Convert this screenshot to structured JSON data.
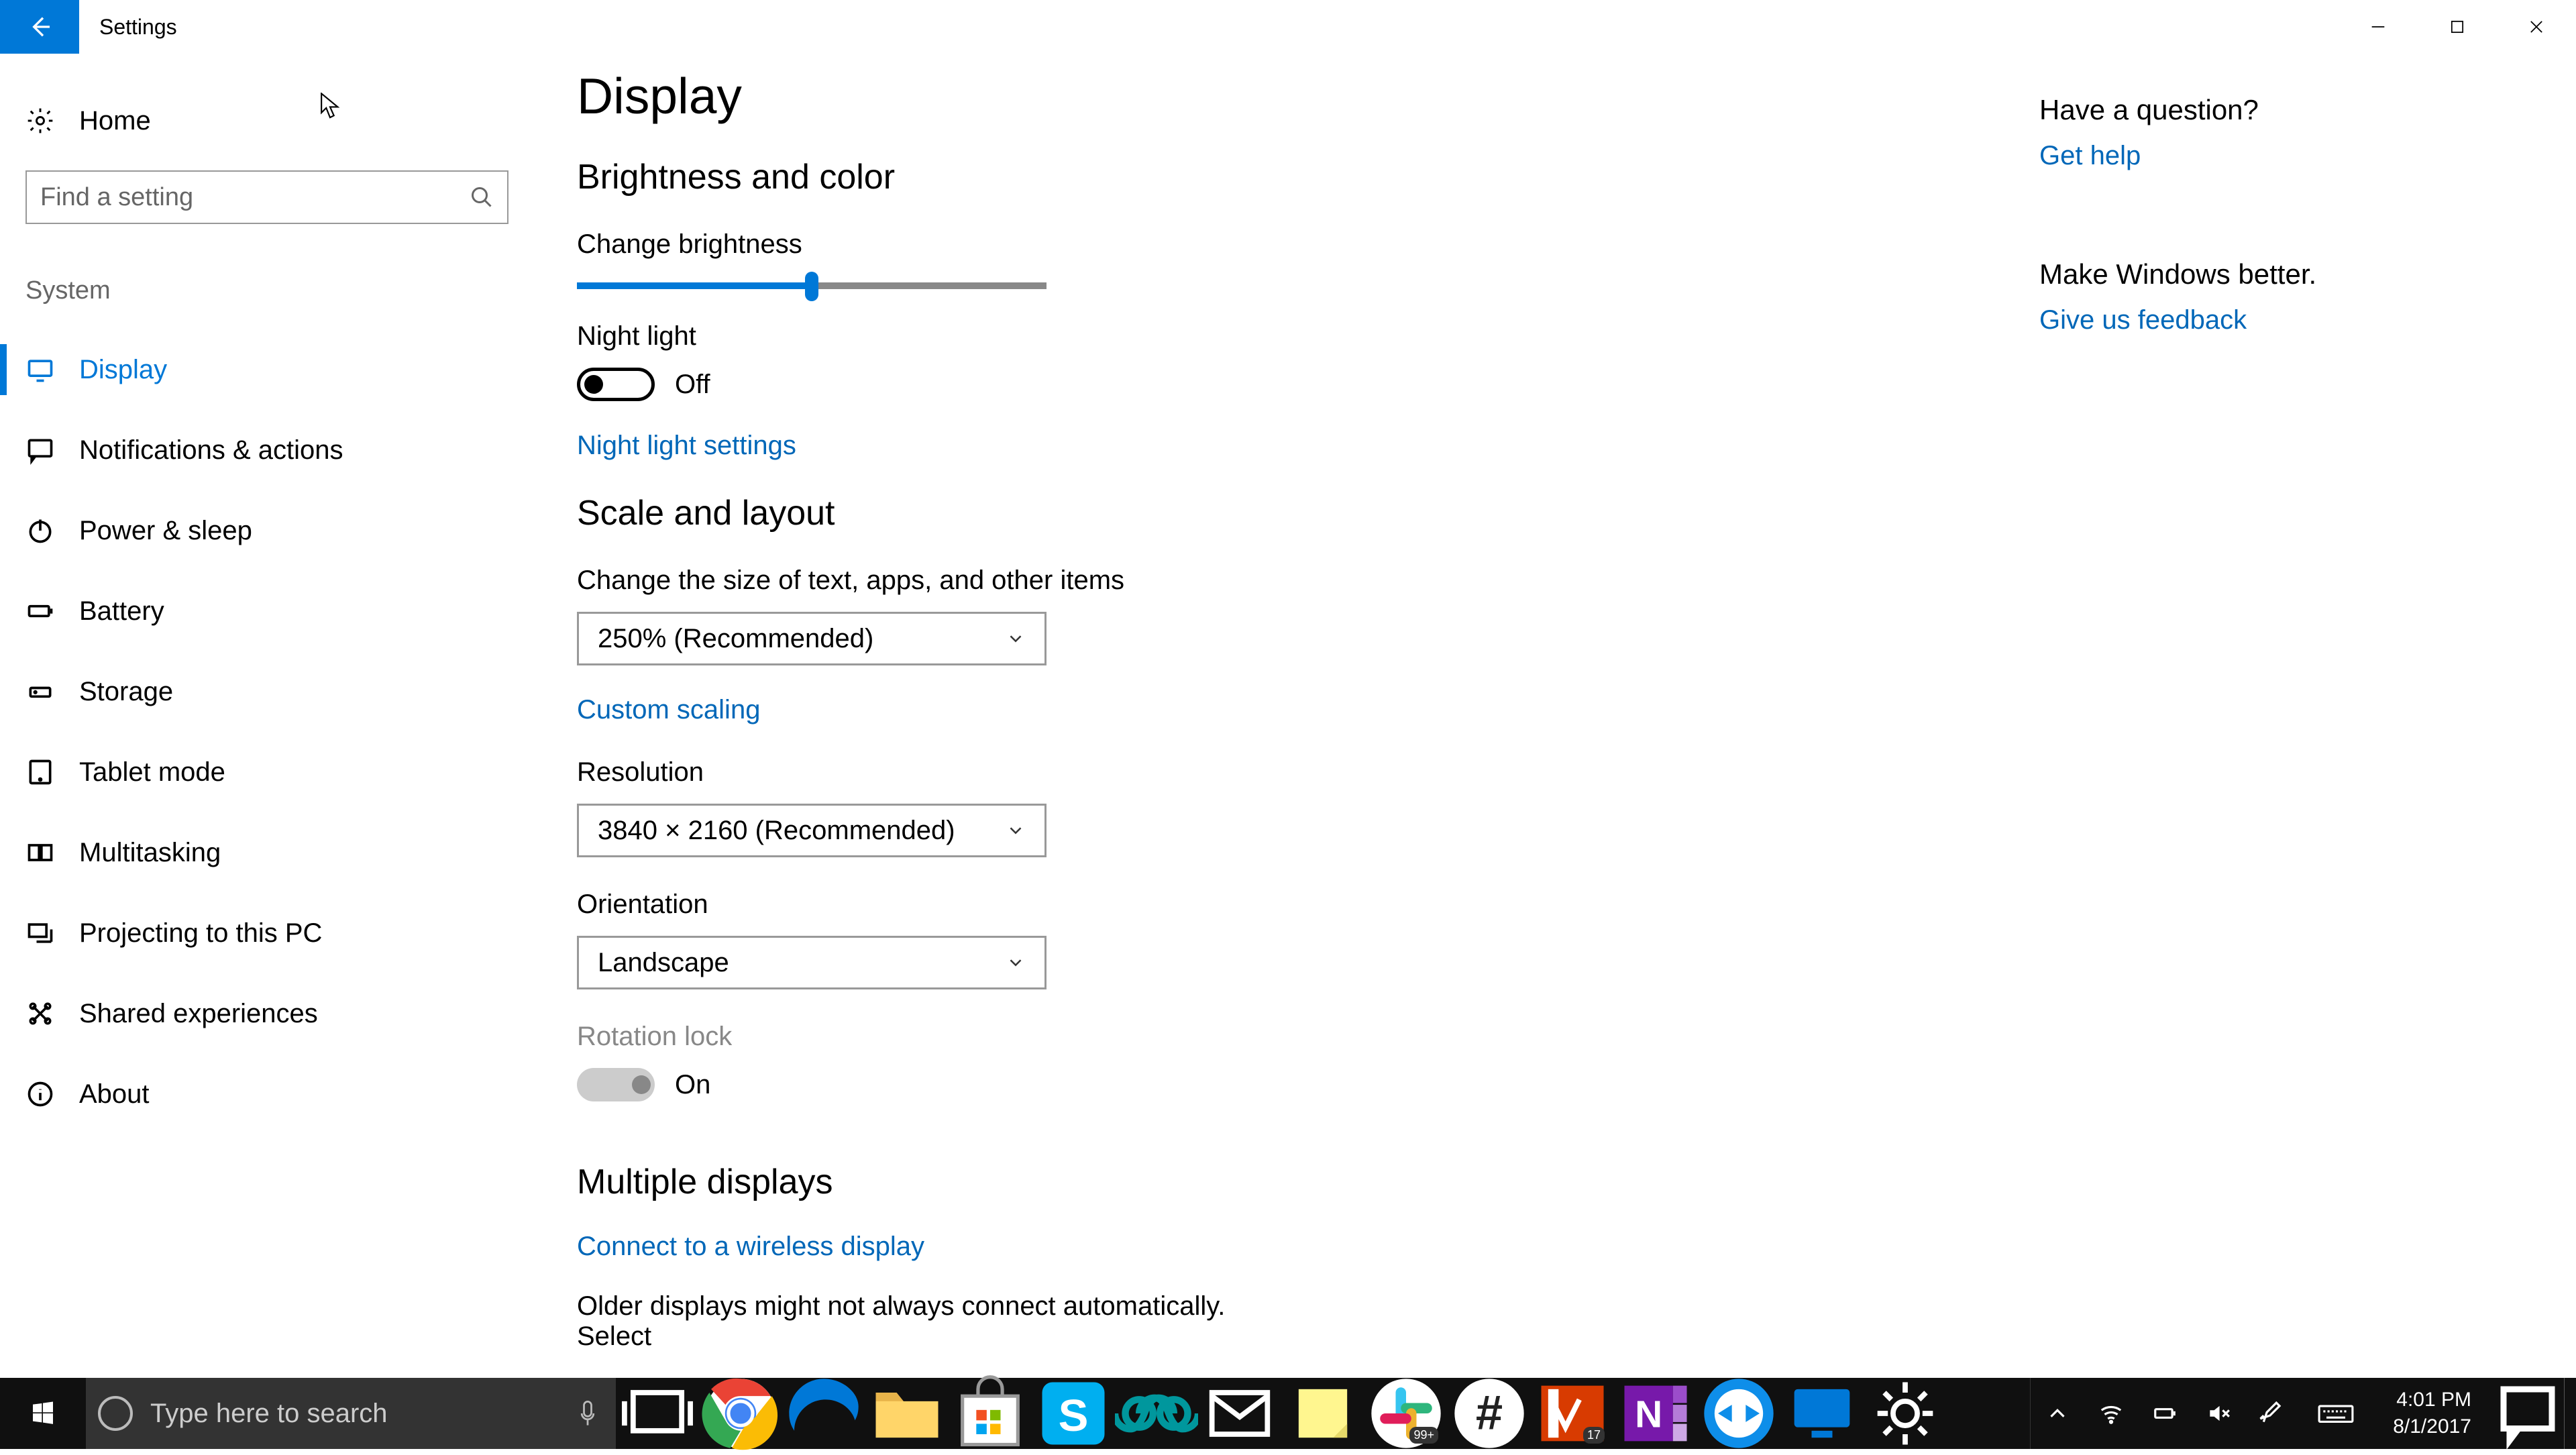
{
  "window": {
    "title": "Settings"
  },
  "sidebar": {
    "home": "Home",
    "search_placeholder": "Find a setting",
    "section": "System",
    "items": [
      {
        "label": "Display",
        "icon": "display-icon",
        "active": true
      },
      {
        "label": "Notifications & actions",
        "icon": "chat-icon",
        "active": false
      },
      {
        "label": "Power & sleep",
        "icon": "power-icon",
        "active": false
      },
      {
        "label": "Battery",
        "icon": "battery-icon",
        "active": false
      },
      {
        "label": "Storage",
        "icon": "storage-icon",
        "active": false
      },
      {
        "label": "Tablet mode",
        "icon": "tablet-icon",
        "active": false
      },
      {
        "label": "Multitasking",
        "icon": "multitask-icon",
        "active": false
      },
      {
        "label": "Projecting to this PC",
        "icon": "project-icon",
        "active": false
      },
      {
        "label": "Shared experiences",
        "icon": "shared-icon",
        "active": false
      },
      {
        "label": "About",
        "icon": "info-icon",
        "active": false
      }
    ]
  },
  "main": {
    "title": "Display",
    "section1": "Brightness and color",
    "brightness_label": "Change brightness",
    "brightness_percent": 50,
    "nightlight_label": "Night light",
    "nightlight_state": "Off",
    "nightlight_settings": "Night light settings",
    "section2": "Scale and layout",
    "scale_label": "Change the size of text, apps, and other items",
    "scale_value": "250% (Recommended)",
    "custom_scaling": "Custom scaling",
    "resolution_label": "Resolution",
    "resolution_value": "3840 × 2160 (Recommended)",
    "orientation_label": "Orientation",
    "orientation_value": "Landscape",
    "rotation_label": "Rotation lock",
    "rotation_state": "On",
    "section3": "Multiple displays",
    "wireless_display": "Connect to a wireless display",
    "older_text": "Older displays might not always connect automatically. Select"
  },
  "right": {
    "q": "Have a question?",
    "help": "Get help",
    "better": "Make Windows better.",
    "feedback": "Give us feedback"
  },
  "taskbar": {
    "search_placeholder": "Type here to search",
    "slack_badge": "99+",
    "onenote_badge": "17",
    "time": "4:01 PM",
    "date": "8/1/2017"
  }
}
